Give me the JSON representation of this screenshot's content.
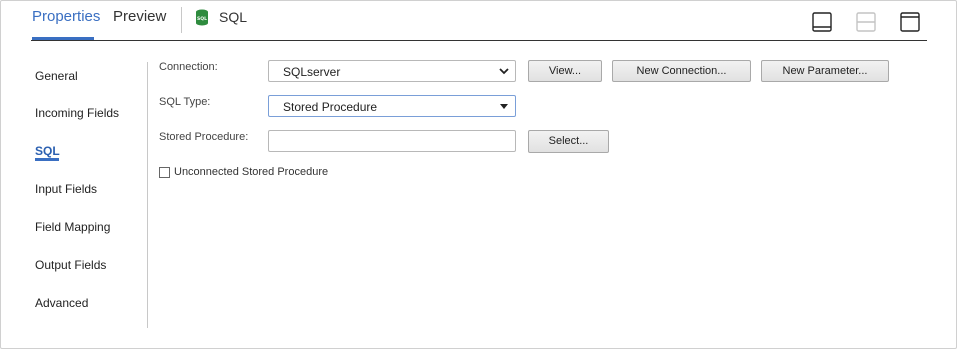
{
  "header": {
    "tabs": [
      {
        "label": "Properties",
        "active": true
      },
      {
        "label": "Preview",
        "active": false
      }
    ],
    "object_label": "SQL",
    "object_icon": "sql-database-icon",
    "layout_icons": [
      "panel-bottom-icon",
      "panel-split-icon",
      "panel-top-icon"
    ],
    "accent_color": "#3a6fc2"
  },
  "nav": {
    "items": [
      {
        "label": "General",
        "active": false
      },
      {
        "label": "Incoming Fields",
        "active": false
      },
      {
        "label": "SQL",
        "active": true
      },
      {
        "label": "Input Fields",
        "active": false
      },
      {
        "label": "Field Mapping",
        "active": false
      },
      {
        "label": "Output Fields",
        "active": false
      },
      {
        "label": "Advanced",
        "active": false
      }
    ]
  },
  "form": {
    "connection": {
      "label": "Connection:",
      "value": "SQLserver",
      "view_button": "View...",
      "new_connection_button": "New Connection...",
      "new_parameter_button": "New Parameter..."
    },
    "sql_type": {
      "label": "SQL Type:",
      "value": "Stored Procedure"
    },
    "stored_procedure": {
      "label": "Stored Procedure:",
      "value": "",
      "select_button": "Select..."
    },
    "unconnected": {
      "label": "Unconnected Stored Procedure",
      "checked": false
    }
  }
}
